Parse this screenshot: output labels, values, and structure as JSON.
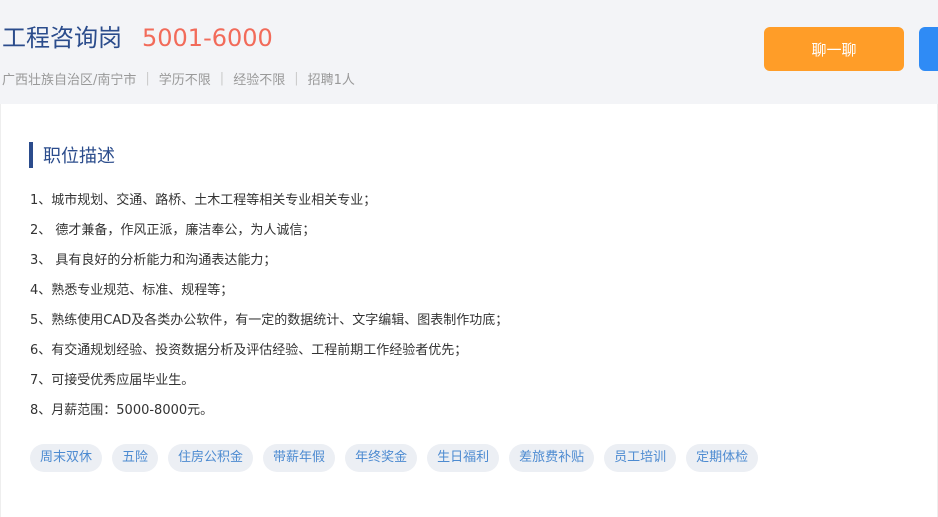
{
  "header": {
    "title": "工程咨询岗",
    "salary": "5001-6000",
    "meta": [
      "广西壮族自治区/南宁市",
      "学历不限",
      "经验不限",
      "招聘1人"
    ],
    "chat_button": "聊一聊"
  },
  "section": {
    "title": "职位描述"
  },
  "description": [
    "1、城市规划、交通、路桥、土木工程等相关专业相关专业；",
    "2、 德才兼备，作风正派，廉洁奉公，为人诚信；",
    "3、 具有良好的分析能力和沟通表达能力；",
    "4、熟悉专业规范、标准、规程等；",
    "5、熟练使用CAD及各类办公软件，有一定的数据统计、文字编辑、图表制作功底；",
    "6、有交通规划经验、投资数据分析及评估经验、工程前期工作经验者优先；",
    "7、可接受优秀应届毕业生。",
    "8、月薪范围：5000-8000元。"
  ],
  "tags": [
    "周末双休",
    "五险",
    "住房公积金",
    "带薪年假",
    "年终奖金",
    "生日福利",
    "差旅费补贴",
    "员工培训",
    "定期体检"
  ],
  "colors": {
    "title": "#2b4c8c",
    "salary": "#f26b5a",
    "chat_button": "#ff9d28",
    "secondary_button": "#2f8bf5",
    "tag_text": "#4d8bd1",
    "tag_bg": "#eceff4"
  }
}
